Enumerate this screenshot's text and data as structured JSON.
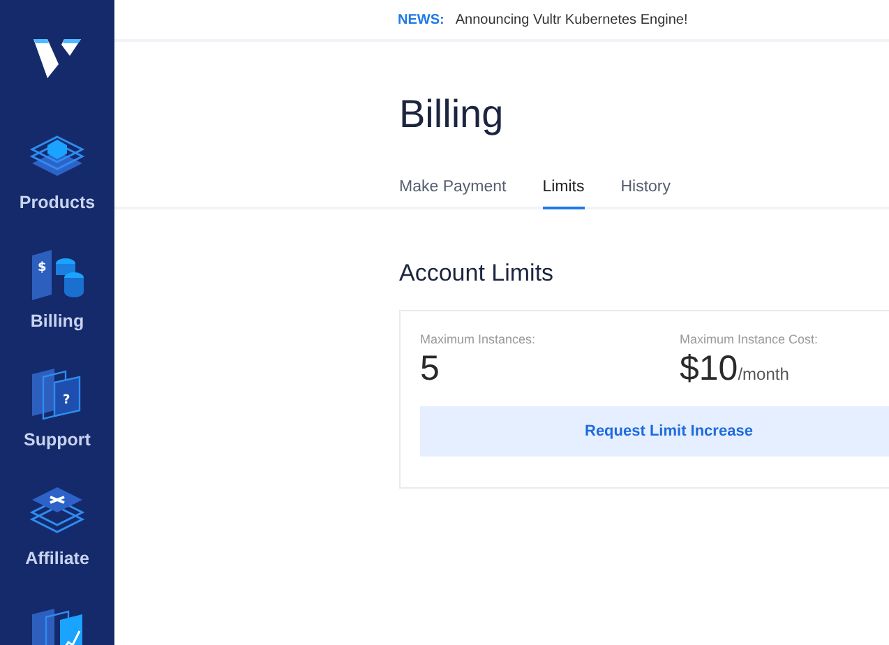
{
  "sidebar": {
    "items": [
      {
        "label": "Products"
      },
      {
        "label": "Billing",
        "icon_text": "$"
      },
      {
        "label": "Support",
        "icon_text": "?"
      },
      {
        "label": "Affiliate"
      }
    ]
  },
  "news": {
    "tag": "NEWS:",
    "text": "Announcing Vultr Kubernetes Engine!"
  },
  "page": {
    "title": "Billing"
  },
  "tabs": [
    {
      "label": "Make Payment",
      "selected": false
    },
    {
      "label": "Limits",
      "selected": true
    },
    {
      "label": "History",
      "selected": false
    }
  ],
  "section": {
    "title": "Account Limits",
    "limits": [
      {
        "label": "Maximum Instances:",
        "value": "5"
      },
      {
        "label": "Maximum Instance Cost:",
        "value": "$10",
        "unit": "/month"
      }
    ],
    "button": "Request Limit Increase"
  }
}
